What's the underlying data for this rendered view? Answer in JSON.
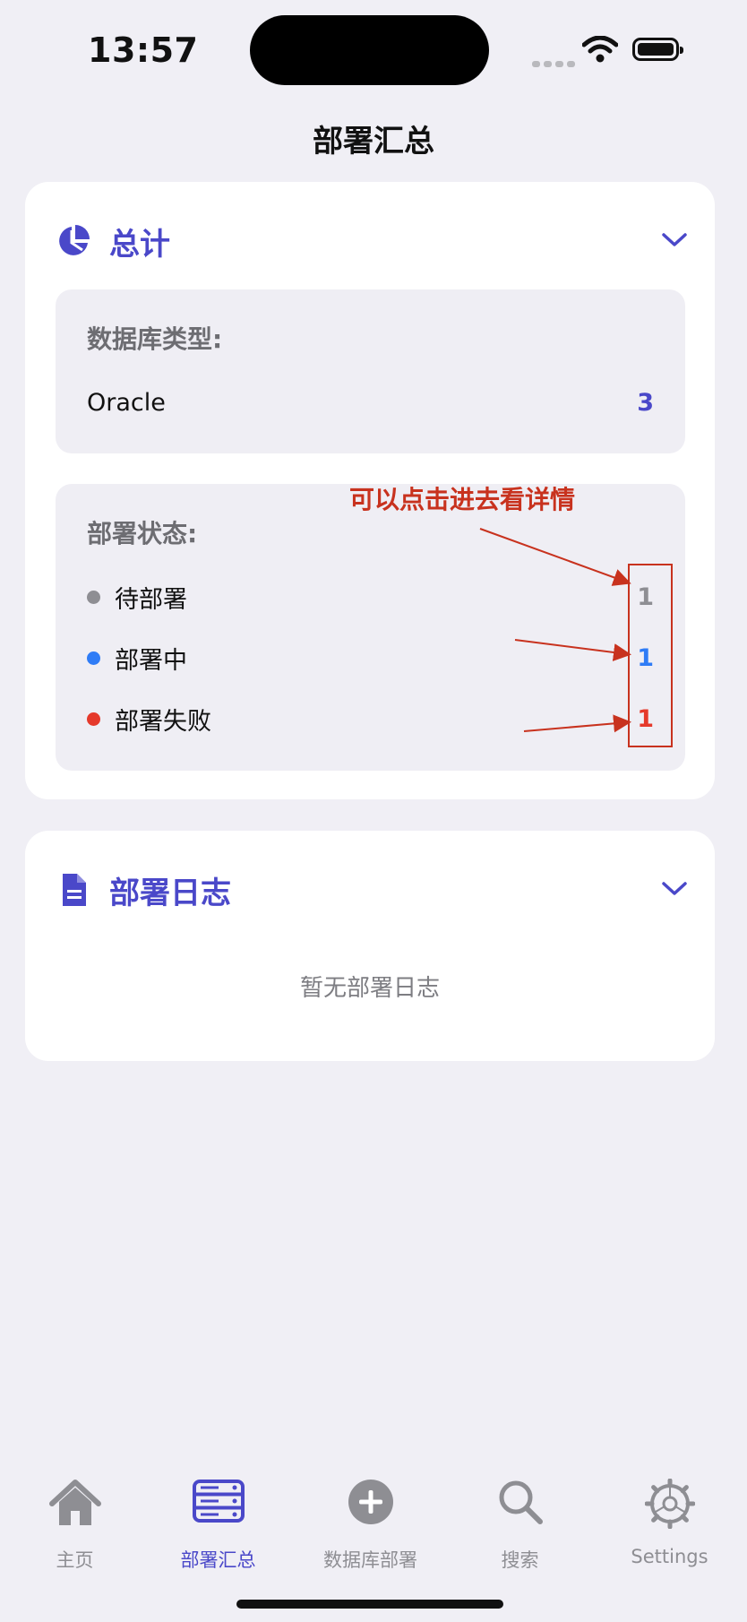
{
  "status": {
    "time": "13:57"
  },
  "header": {
    "title": "部署汇总"
  },
  "summary": {
    "title": "总计",
    "db_type_label": "数据库类型:",
    "db_types": [
      {
        "name": "Oracle",
        "count": "3"
      }
    ],
    "status_label": "部署状态:",
    "statuses": [
      {
        "name": "待部署",
        "count": "1",
        "color": "#8e8e93"
      },
      {
        "name": "部署中",
        "count": "1",
        "color": "#2f7cf6"
      },
      {
        "name": "部署失败",
        "count": "1",
        "color": "#e5392b"
      }
    ]
  },
  "annotation": {
    "note": "可以点击进去看详情",
    "color": "#c8321e"
  },
  "logs": {
    "title": "部署日志",
    "empty": "暂无部署日志"
  },
  "tabbar": {
    "tabs": [
      {
        "label": "主页",
        "icon": "house-icon"
      },
      {
        "label": "部署汇总",
        "icon": "server-stack-icon",
        "active": true
      },
      {
        "label": "数据库部署",
        "icon": "plus-circle-icon"
      },
      {
        "label": "搜索",
        "icon": "magnifier-icon"
      },
      {
        "label": "Settings",
        "icon": "gear-icon"
      }
    ]
  },
  "colors": {
    "accent": "#4a48c9",
    "background": "#f0eff5"
  }
}
